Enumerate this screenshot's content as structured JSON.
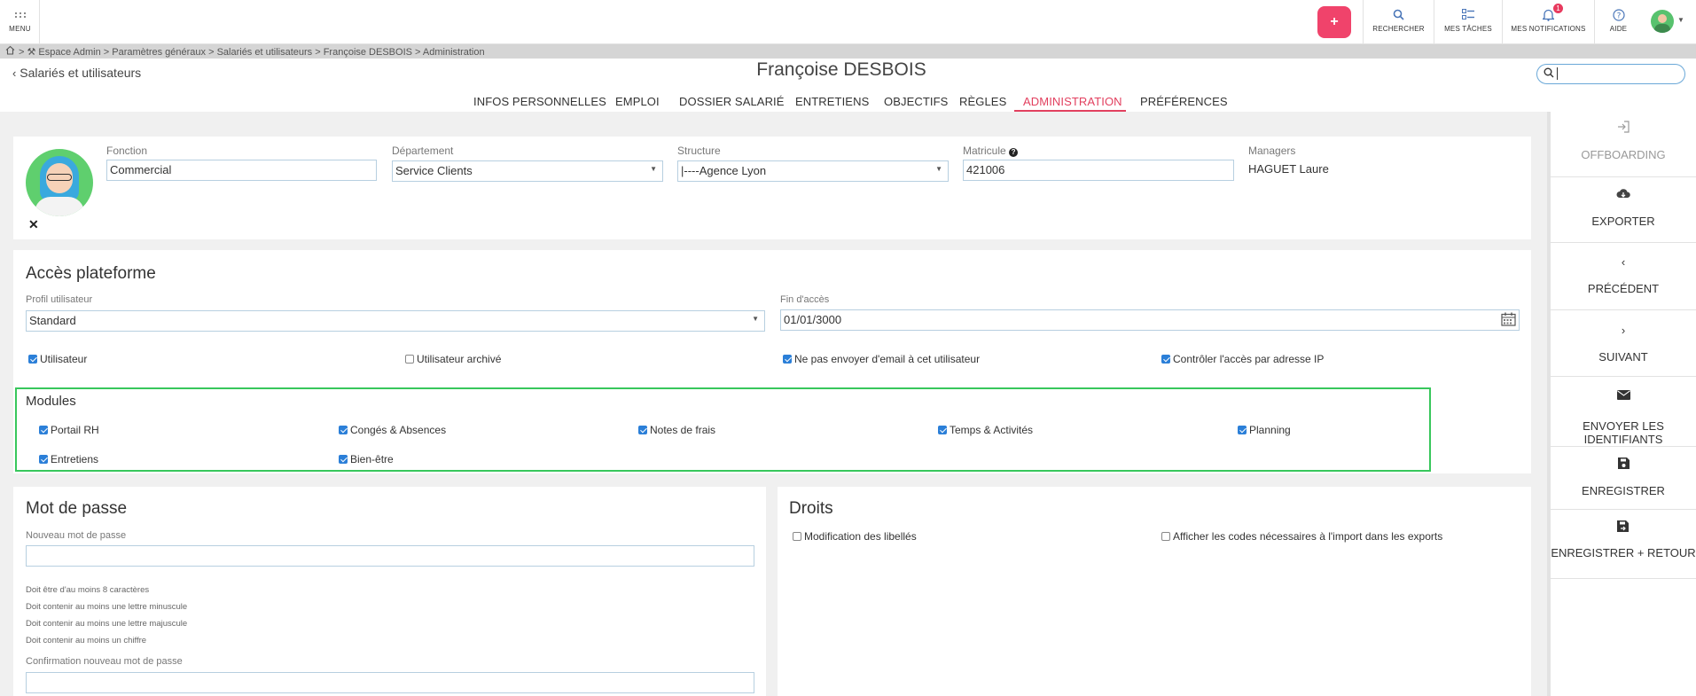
{
  "topbar": {
    "menu_label": "MENU",
    "add_symbol": "+",
    "actions": [
      {
        "label": "RECHERCHER",
        "icon": "search-icon"
      },
      {
        "label": "MES TÂCHES",
        "icon": "tasks-icon"
      },
      {
        "label": "MES NOTIFICATIONS",
        "icon": "bell-icon",
        "badge": "1"
      },
      {
        "label": "AIDE",
        "icon": "help-icon"
      }
    ],
    "accent_color": "#f0436b"
  },
  "breadcrumb": {
    "text": "> ⚒ Espace Admin > Paramètres généraux > Salariés et utilisateurs > Françoise DESBOIS > Administration"
  },
  "header": {
    "back_label": "Salariés et utilisateurs",
    "employee_name": "Françoise DESBOIS",
    "search_value": ""
  },
  "tabs": [
    {
      "label": "INFOS PERSONNELLES",
      "active": false
    },
    {
      "label": "EMPLOI",
      "active": false
    },
    {
      "label": "DOSSIER SALARIÉ",
      "active": false
    },
    {
      "label": "ENTRETIENS",
      "active": false
    },
    {
      "label": "OBJECTIFS",
      "active": false
    },
    {
      "label": "RÈGLES",
      "active": false
    },
    {
      "label": "ADMINISTRATION",
      "active": true
    },
    {
      "label": "PRÉFÉRENCES",
      "active": false
    }
  ],
  "identity": {
    "fonction_label": "Fonction",
    "fonction_value": "Commercial",
    "departement_label": "Département",
    "departement_value": "Service Clients",
    "structure_label": "Structure",
    "structure_value": "|----Agence Lyon",
    "matricule_label": "Matricule",
    "matricule_value": "421006",
    "managers_label": "Managers",
    "managers_value": "HAGUET Laure"
  },
  "access": {
    "title": "Accès plateforme",
    "profil_label": "Profil utilisateur",
    "profil_value": "Standard",
    "fin_label": "Fin d'accès",
    "fin_value": "01/01/3000",
    "options": [
      {
        "label": "Utilisateur",
        "checked": true
      },
      {
        "label": "Utilisateur archivé",
        "checked": false
      },
      {
        "label": "Ne pas envoyer d'email à cet utilisateur",
        "checked": true
      },
      {
        "label": "Contrôler l'accès par adresse IP",
        "checked": true
      }
    ]
  },
  "modules": {
    "title": "Modules",
    "items": [
      {
        "label": "Portail RH",
        "checked": true
      },
      {
        "label": "Congés & Absences",
        "checked": true
      },
      {
        "label": "Notes de frais",
        "checked": true
      },
      {
        "label": "Temps & Activités",
        "checked": true
      },
      {
        "label": "Planning",
        "checked": true
      },
      {
        "label": "Entretiens",
        "checked": true
      },
      {
        "label": "Bien-être",
        "checked": true
      }
    ],
    "highlight_color": "#38c75c"
  },
  "password": {
    "title": "Mot de passe",
    "new_label": "Nouveau mot de passe",
    "new_value": "",
    "rules": [
      "Doit être d'au moins 8 caractères",
      "Doit contenir au moins une lettre minuscule",
      "Doit contenir au moins une lettre majuscule",
      "Doit contenir au moins un chiffre"
    ],
    "confirm_label": "Confirmation nouveau mot de passe",
    "confirm_value": ""
  },
  "rights": {
    "title": "Droits",
    "options": [
      {
        "label": "Modification des libellés",
        "checked": false
      },
      {
        "label": "Afficher les codes nécessaires à l'import dans les exports",
        "checked": false
      }
    ]
  },
  "sidepanel": {
    "buttons": [
      {
        "label": "OFFBOARDING",
        "icon": "sign-in-icon",
        "disabled": true
      },
      {
        "label": "EXPORTER",
        "icon": "cloud-download-icon"
      },
      {
        "label": "PRÉCÉDENT",
        "icon": "chevron-left-icon"
      },
      {
        "label": "SUIVANT",
        "icon": "chevron-right-icon"
      },
      {
        "label": "ENVOYER LES IDENTIFIANTS",
        "icon": "envelope-icon"
      },
      {
        "label": "ENREGISTRER",
        "icon": "save-icon"
      },
      {
        "label": "ENREGISTRER + RETOUR",
        "icon": "save-return-icon"
      }
    ]
  }
}
